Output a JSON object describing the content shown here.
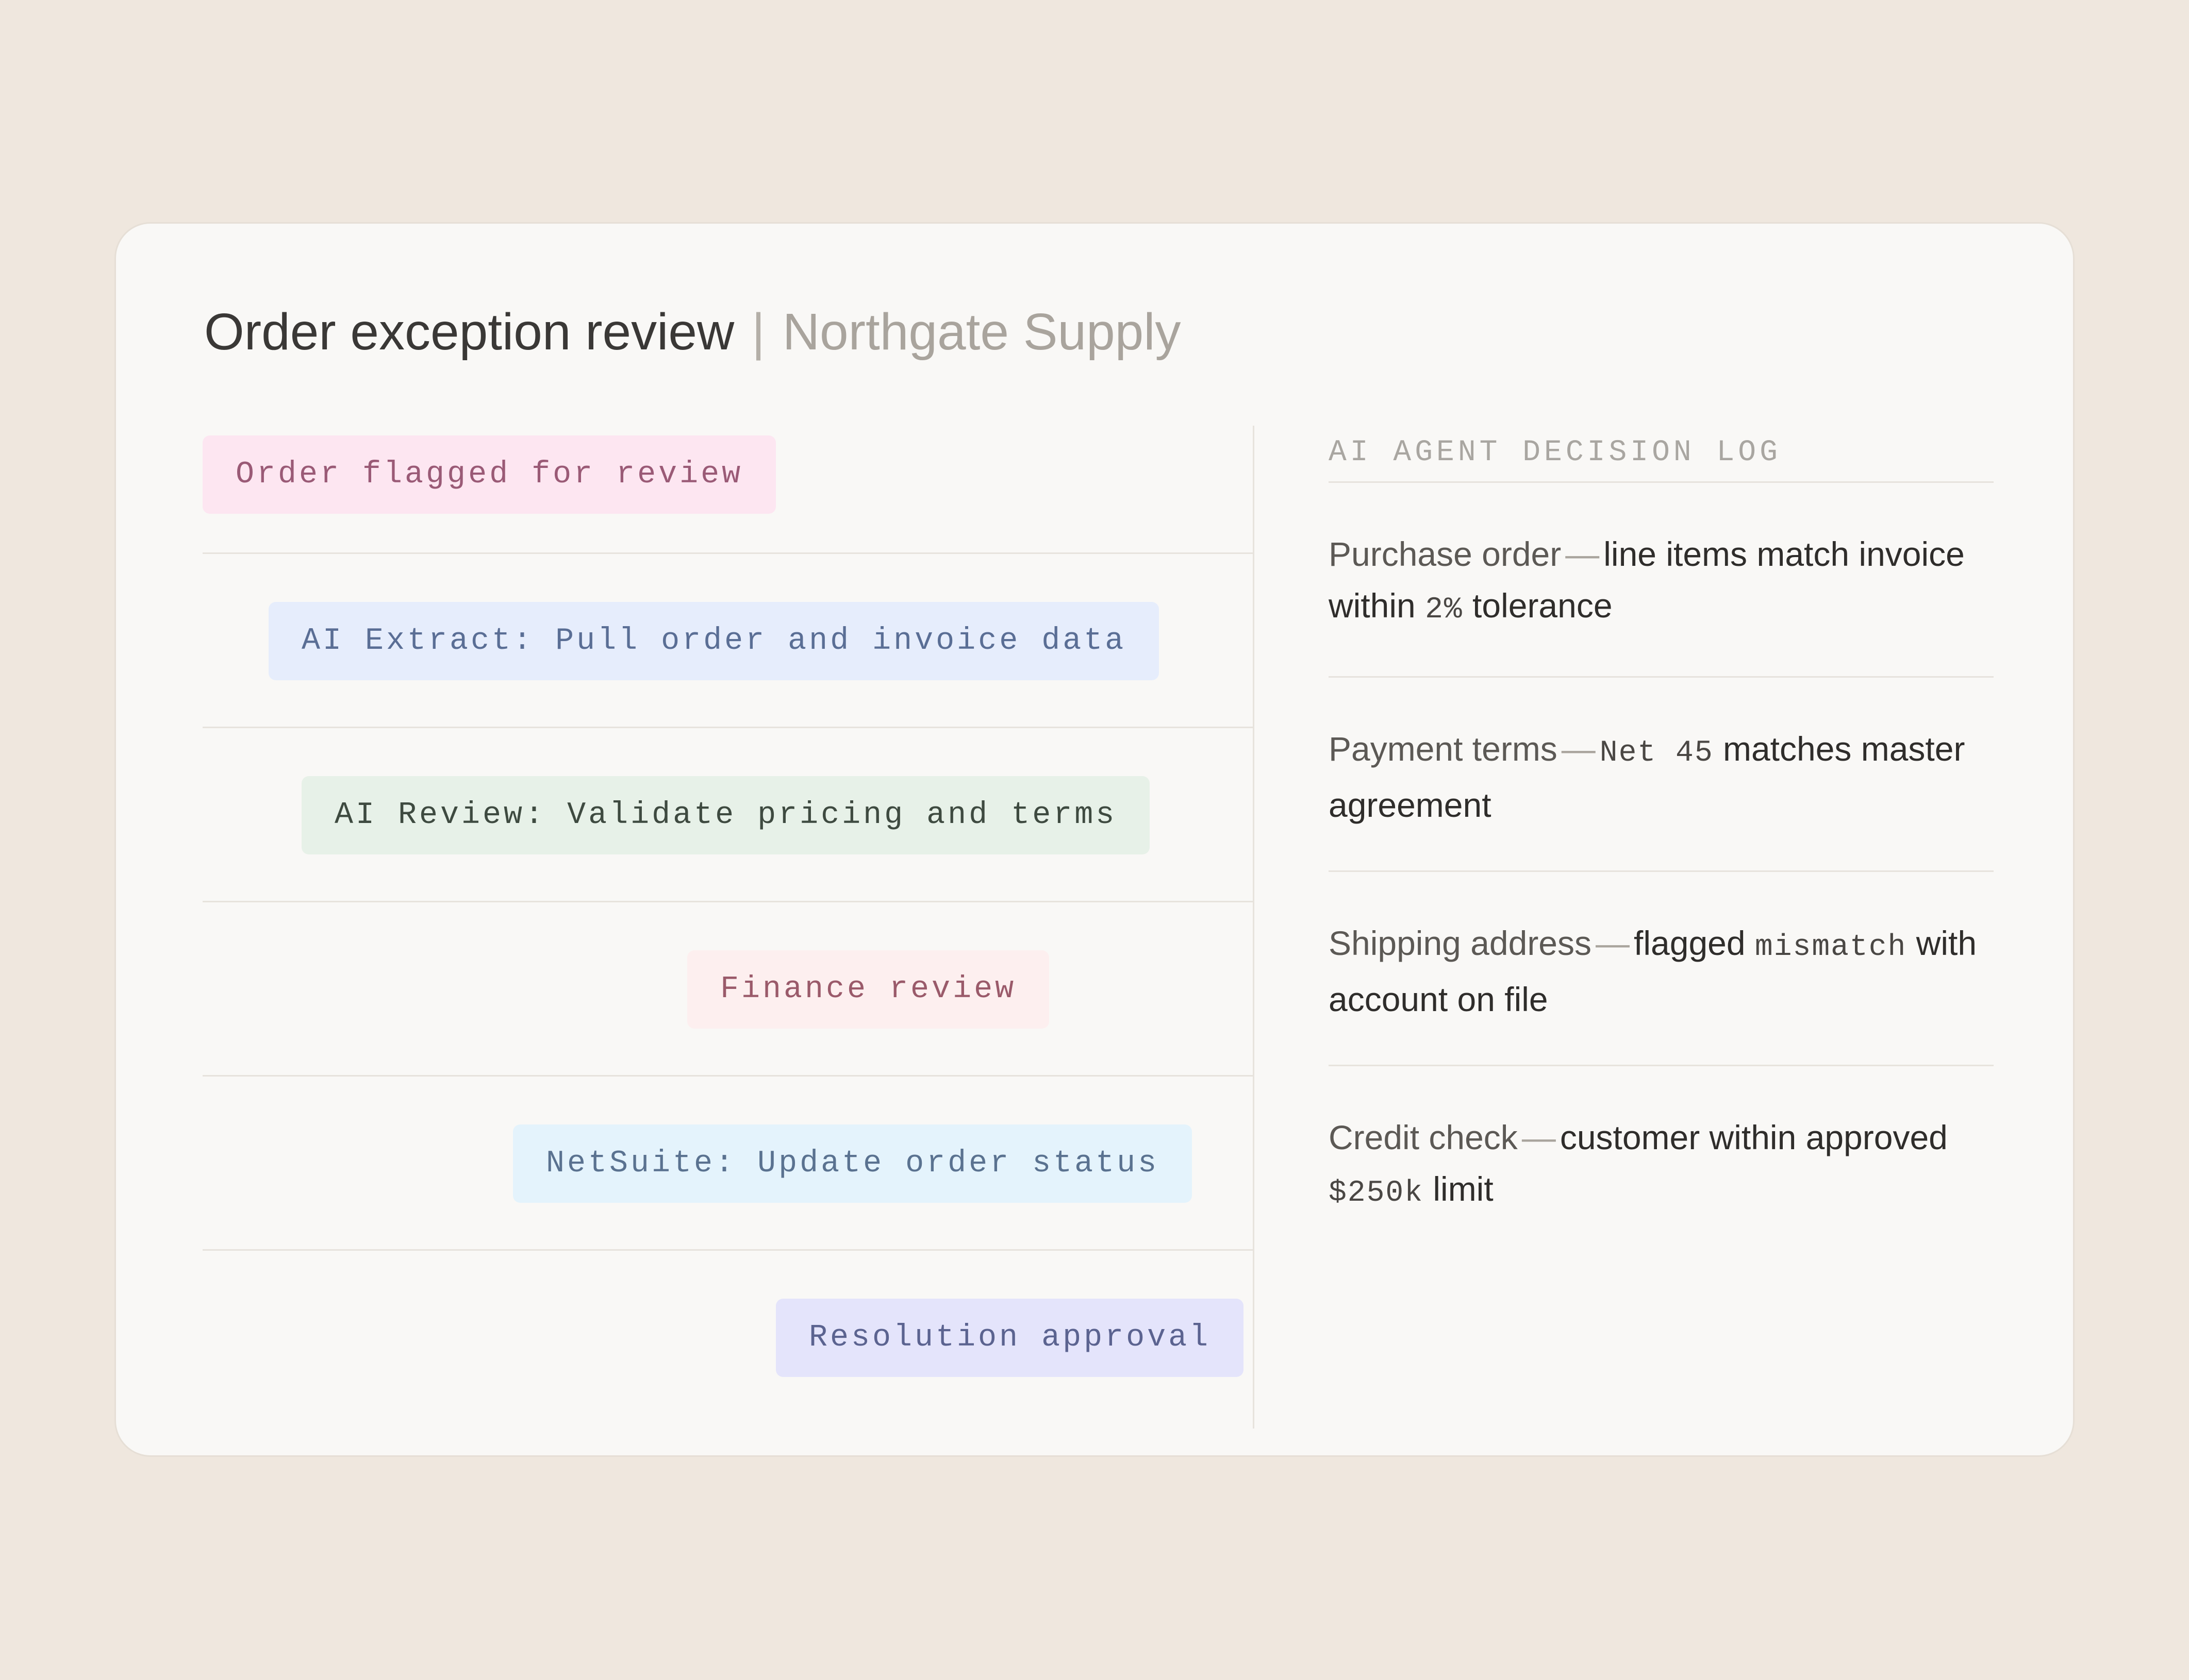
{
  "header": {
    "title": "Order exception review",
    "separator": "|",
    "subtitle": "Northgate Supply"
  },
  "workflow": {
    "steps": [
      {
        "label": "Order flagged for review",
        "bg": "#FDE6F1",
        "fg": "#9A5A76"
      },
      {
        "label": "AI Extract: Pull order and invoice data",
        "bg": "#E6EDFC",
        "fg": "#5A6E95"
      },
      {
        "label": "AI Review: Validate pricing and terms",
        "bg": "#E7F1E8",
        "fg": "#3E4A40"
      },
      {
        "label": "Finance review",
        "bg": "#FDEFEF",
        "fg": "#9A5A6A"
      },
      {
        "label": "NetSuite: Update order status",
        "bg": "#E4F3FC",
        "fg": "#5A7290"
      },
      {
        "label": "Resolution approval",
        "bg": "#E4E4FB",
        "fg": "#5B6390"
      }
    ]
  },
  "decision_log": {
    "title": "AI AGENT DECISION LOG",
    "entries": [
      {
        "label": "Purchase order",
        "dash": "—",
        "text_1": "line items match invoice within ",
        "mono": "2%",
        "text_2": " tolerance"
      },
      {
        "label": "Payment terms",
        "dash": "—",
        "mono": "Net 45",
        "text_2": " matches master agreement"
      },
      {
        "label": "Shipping address",
        "dash": "—",
        "text_1": "flagged ",
        "mono": "mismatch",
        "text_2": " with account on file"
      },
      {
        "label": "Credit check",
        "dash": "—",
        "text_1": "customer within approved ",
        "mono": "$250k",
        "text_2": " limit"
      }
    ]
  }
}
